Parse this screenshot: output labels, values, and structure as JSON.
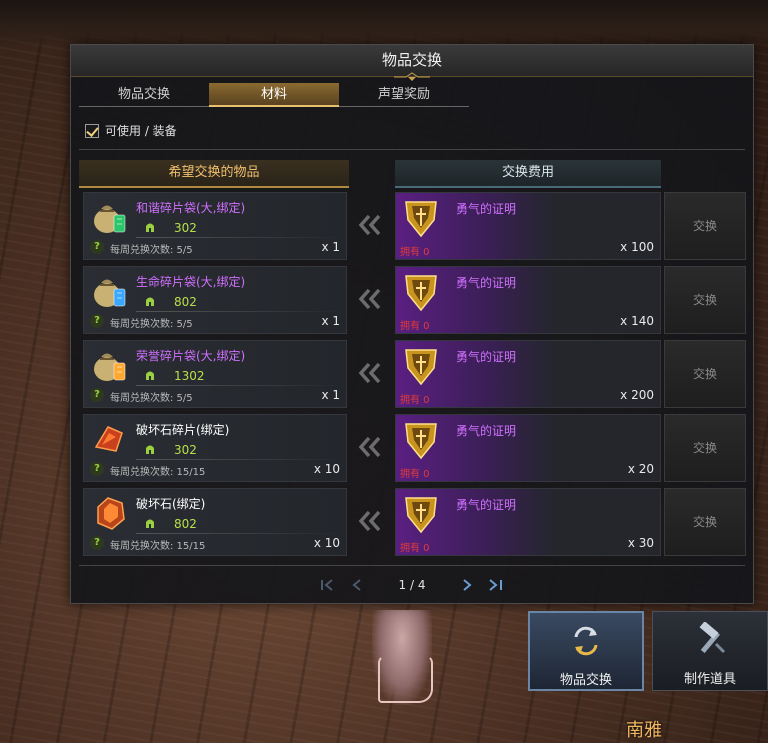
{
  "window": {
    "title": "物品交换",
    "tabs": [
      {
        "label": "物品交换",
        "active": false
      },
      {
        "label": "材料",
        "active": true
      },
      {
        "label": "声望奖励",
        "active": false
      }
    ],
    "filter_label": "可使用 / 装备",
    "filter_checked": true,
    "col_wanted": "希望交换的物品",
    "col_cost": "交换费用"
  },
  "rows": [
    {
      "item_name": "和谐碎片袋(大,绑定)",
      "name_color": "purple",
      "score": "302",
      "weekly": "每周兑换次数: 5/5",
      "item_qty": "x 1",
      "icon": "green-shard-bag-icon",
      "cost_name": "勇气的证明",
      "owned": "拥有 0",
      "cost_qty": "x 100",
      "button": "交换"
    },
    {
      "item_name": "生命碎片袋(大,绑定)",
      "name_color": "purple",
      "score": "802",
      "weekly": "每周兑换次数: 5/5",
      "item_qty": "x 1",
      "icon": "blue-shard-bag-icon",
      "cost_name": "勇气的证明",
      "owned": "拥有 0",
      "cost_qty": "x 140",
      "button": "交换"
    },
    {
      "item_name": "荣誉碎片袋(大,绑定)",
      "name_color": "purple",
      "score": "1302",
      "weekly": "每周兑换次数: 5/5",
      "item_qty": "x 1",
      "icon": "orange-shard-bag-icon",
      "cost_name": "勇气的证明",
      "owned": "拥有 0",
      "cost_qty": "x 200",
      "button": "交换"
    },
    {
      "item_name": "破坏石碎片(绑定)",
      "name_color": "white",
      "score": "302",
      "weekly": "每周兑换次数: 15/15",
      "item_qty": "x 10",
      "icon": "destruction-stone-fragment-icon",
      "cost_name": "勇气的证明",
      "owned": "拥有 0",
      "cost_qty": "x 20",
      "button": "交换"
    },
    {
      "item_name": "破坏石(绑定)",
      "name_color": "white",
      "score": "802",
      "weekly": "每周兑换次数: 15/15",
      "item_qty": "x 10",
      "icon": "destruction-stone-icon",
      "cost_name": "勇气的证明",
      "owned": "拥有 0",
      "cost_qty": "x 30",
      "button": "交换"
    }
  ],
  "pager": {
    "text": "1 / 4"
  },
  "quick_buttons": [
    {
      "label": "物品交换",
      "icon": "exchange-arrows-icon",
      "active": true
    },
    {
      "label": "制作道具",
      "icon": "hammer-craft-icon",
      "active": false
    }
  ],
  "npc_name": "南雅",
  "colors": {
    "purple_text": "#d070ff",
    "score_green": "#b6e04a",
    "owned_red": "#e03a3a",
    "gold_accent": "#f0c070"
  }
}
